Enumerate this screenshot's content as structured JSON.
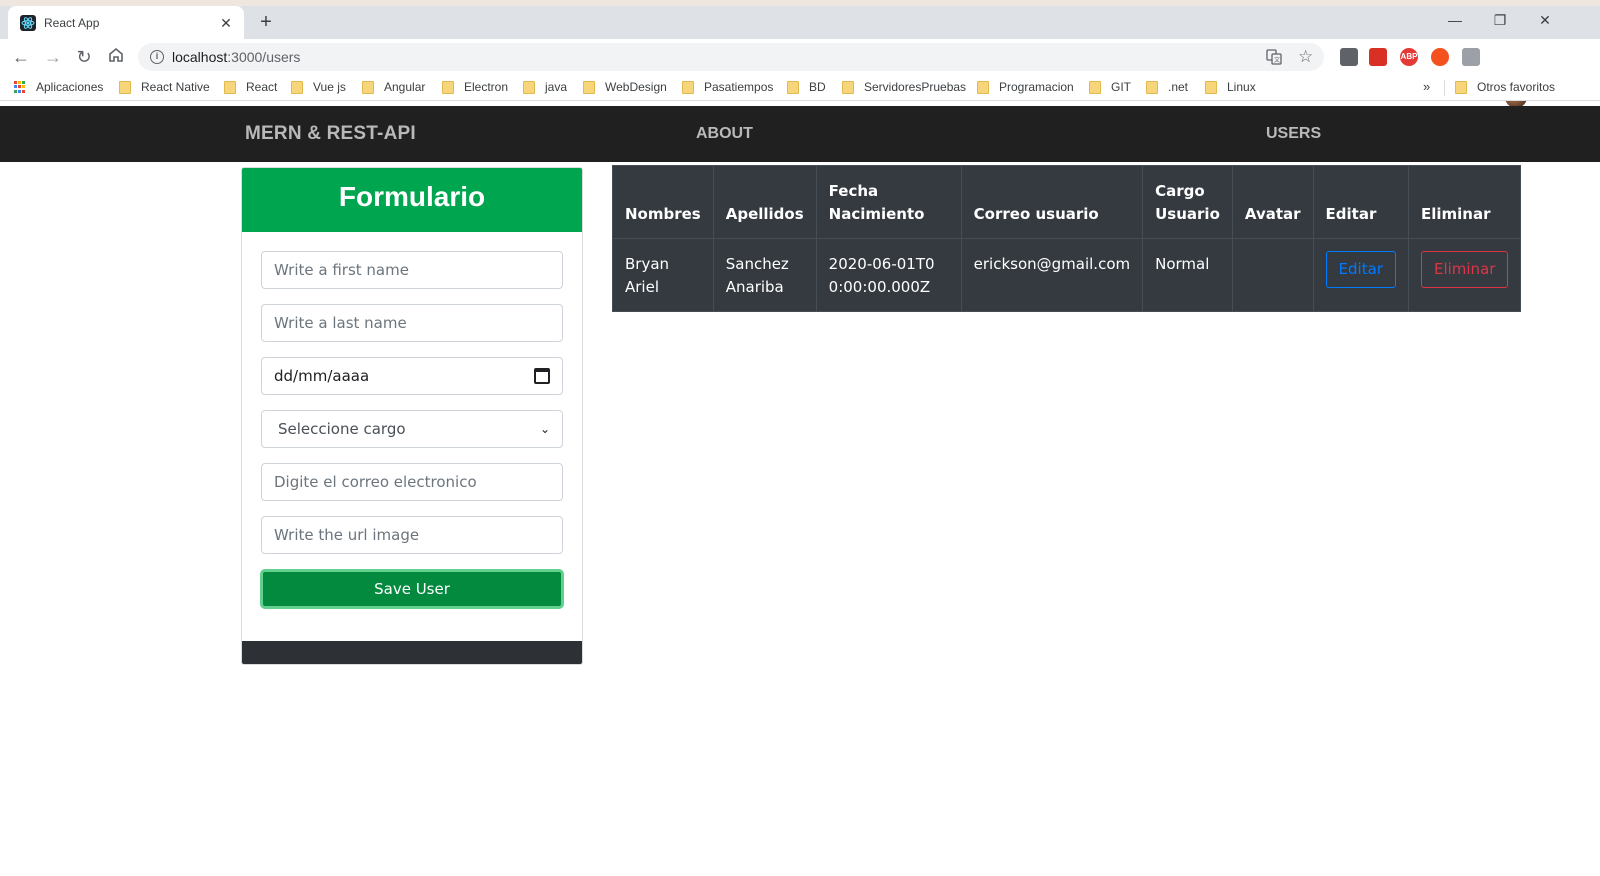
{
  "browser": {
    "tab_title": "React App",
    "url_host": "localhost",
    "url_path": ":3000/users",
    "bookmarks": [
      "Aplicaciones",
      "React Native",
      "React",
      "Vue js",
      "Angular",
      "Electron",
      "java",
      "WebDesign",
      "Pasatiempos",
      "BD",
      "ServidoresPruebas",
      "Programacion",
      "GIT",
      ".net",
      "Linux"
    ],
    "other_bookmarks": "Otros favoritos",
    "more_bookmarks": "»",
    "icons": [
      "back-icon",
      "forward-icon",
      "reload-icon",
      "home-icon",
      "info-icon",
      "translate-icon",
      "star-icon"
    ]
  },
  "navbar": {
    "brand": "MERN & REST-API",
    "links": [
      "ABOUT",
      "USERS"
    ]
  },
  "form": {
    "title": "Formulario",
    "first_name_placeholder": "Write a first name",
    "last_name_placeholder": "Write a last name",
    "date_placeholder": "dd/mm/aaaa",
    "cargo_selected": "Seleccione cargo",
    "email_placeholder": "Digite el correo electronico",
    "image_placeholder": "Write the url image",
    "save_label": "Save User",
    "accent_color": "#00a64f"
  },
  "table": {
    "headers": [
      "Nombres",
      "Apellidos",
      "Fecha Nacimiento",
      "Correo usuario",
      "Cargo Usuario",
      "Avatar",
      "Editar",
      "Eliminar"
    ],
    "rows": [
      {
        "nombres": "Bryan Ariel",
        "apellidos": "Sanchez Anariba",
        "fecha": "2020-06-01T00:00:00.000Z",
        "correo": "erickson@gmail.com",
        "cargo": "Normal",
        "avatar": "",
        "edit_label": "Editar",
        "delete_label": "Eliminar"
      }
    ],
    "colors": {
      "background": "#343a40",
      "edit": "#007bff",
      "delete": "#dc3545"
    }
  }
}
